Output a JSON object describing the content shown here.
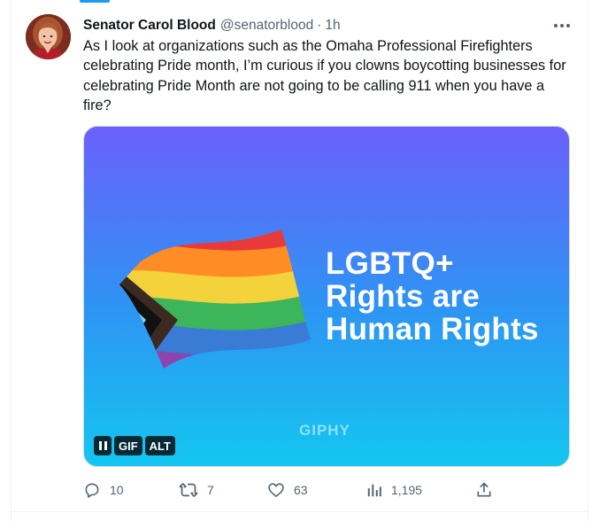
{
  "post": {
    "author_name": "Senator Carol Blood",
    "author_handle": "@senatorblood",
    "separator": "·",
    "time": "1h",
    "text": "As I look at organizations such as the Omaha Professional Firefighters celebrating Pride month, I’m curious if you clowns boycotting businesses for celebrating Pride Month are not going to be calling 911 when you have a fire?"
  },
  "media": {
    "headline_lines": [
      "LGBTQ+",
      "Rights are",
      "Human Rights"
    ],
    "watermark": "GIPHY",
    "controls": {
      "gif_label": "GIF",
      "alt_label": "ALT"
    },
    "icons": [
      "pause-icon",
      "progress-pride-flag"
    ]
  },
  "actions": {
    "reply_count": "10",
    "repost_count": "7",
    "like_count": "63",
    "view_count": "1,195"
  },
  "colors": {
    "accent": "#1d9bf0",
    "text": "#0f1419",
    "secondary_text": "#536471",
    "gradient_top": "#6b60fb",
    "gradient_bottom": "#14c6f0"
  },
  "icon_names": {
    "more": "more-horizontal-icon",
    "reply": "reply-icon",
    "repost": "repost-icon",
    "like": "heart-icon",
    "views": "views-chart-icon",
    "share": "share-icon"
  }
}
